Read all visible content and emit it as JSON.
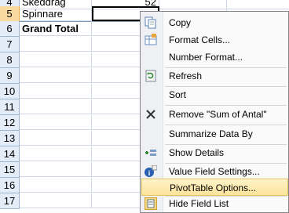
{
  "rows": [
    {
      "num": "4",
      "a": "Skeddrag",
      "b": "52",
      "active": false
    },
    {
      "num": "5",
      "a": "Spinnare",
      "b": "",
      "active": true
    },
    {
      "num": "6",
      "a": "Grand Total",
      "b": "",
      "active": false
    },
    {
      "num": "7"
    },
    {
      "num": "8"
    },
    {
      "num": "9"
    },
    {
      "num": "10"
    },
    {
      "num": "11"
    },
    {
      "num": "12"
    },
    {
      "num": "13"
    },
    {
      "num": "14"
    },
    {
      "num": "15"
    },
    {
      "num": "16"
    },
    {
      "num": "17"
    }
  ],
  "menu": {
    "items": [
      {
        "label": "Copy",
        "icon": "copy-icon"
      },
      {
        "label": "Format Cells...",
        "icon": "format-cells-icon"
      },
      {
        "label": "Number Format...",
        "icon": ""
      },
      {
        "label": "Refresh",
        "icon": "refresh-icon"
      },
      {
        "label": "Sort",
        "icon": ""
      },
      {
        "label": "Remove \"Sum of Antal\"",
        "icon": "remove-x-icon"
      },
      {
        "label": "Summarize Data By",
        "icon": ""
      },
      {
        "label": "Show Details",
        "icon": "show-details-icon"
      },
      {
        "label": "Value Field Settings...",
        "icon": "info-icon"
      },
      {
        "label": "PivotTable Options...",
        "icon": ""
      },
      {
        "label": "Hide Field List",
        "icon": "field-list-icon"
      }
    ]
  }
}
